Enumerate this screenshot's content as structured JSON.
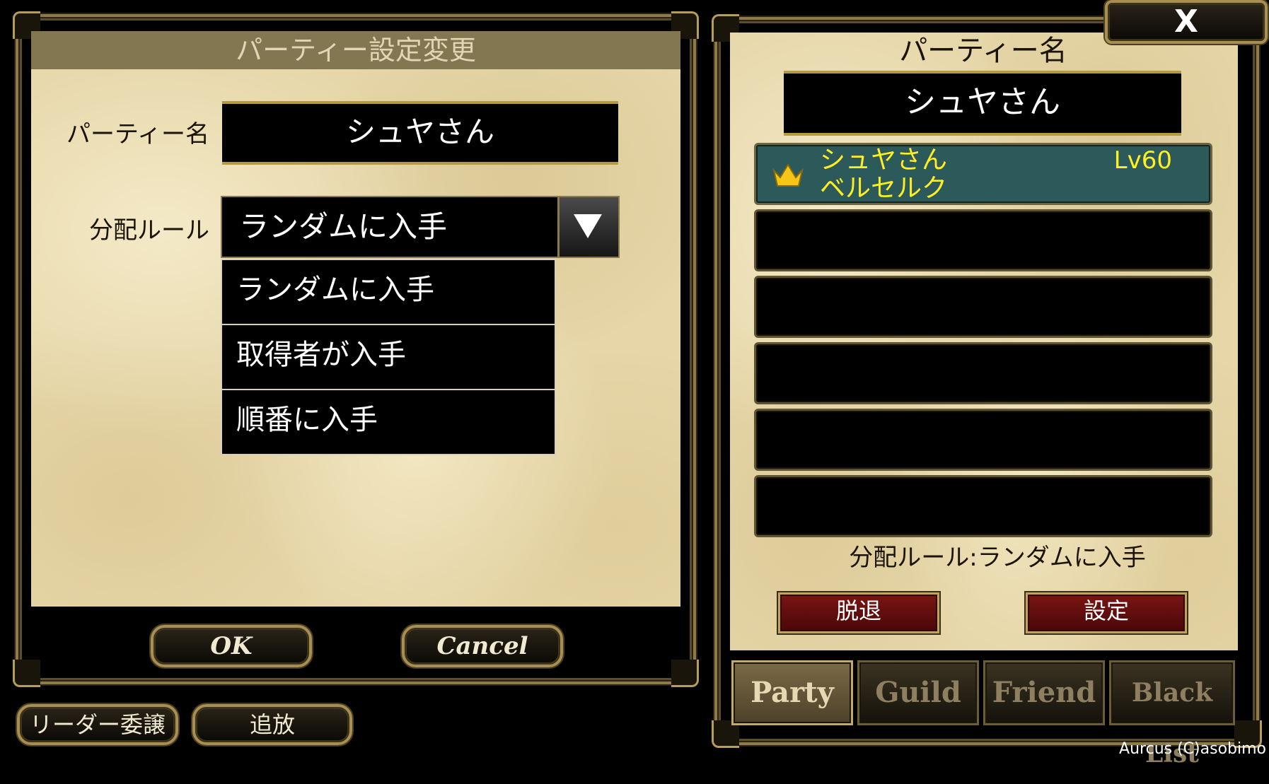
{
  "settings_dialog": {
    "title": "パーティー設定変更",
    "party_name_label": "パーティー名",
    "party_name_value": "シュヤさん",
    "distribution_label": "分配ルール",
    "distribution_selected": "ランダムに入手",
    "dropdown_options": [
      "ランダムに入手",
      "取得者が入手",
      "順番に入手"
    ],
    "ok_label": "OK",
    "cancel_label": "Cancel"
  },
  "bottom_buttons": {
    "transfer_leader_label": "リーダー委譲",
    "kick_label": "追放"
  },
  "party_panel": {
    "close_label": "X",
    "party_name_header": "パーティー名",
    "party_name_value": "シュヤさん",
    "members": [
      {
        "name": "シュヤさん",
        "class": "ベルセルク",
        "level": "Lv60",
        "is_leader": true
      }
    ],
    "empty_slots": 5,
    "distribution_rule_text": "分配ルール:ランダムに入手",
    "leave_label": "脱退",
    "settings_label": "設定",
    "tabs": [
      {
        "label": "Party",
        "active": true
      },
      {
        "label": "Guild",
        "active": false
      },
      {
        "label": "Friend",
        "active": false
      },
      {
        "label": "Black List",
        "active": false
      }
    ]
  },
  "copyright": "Aurcus (C)asobimo",
  "colors": {
    "member_row_bg": "#2c5a5a",
    "member_text": "#ffee22",
    "leader_icon": "#f5c518",
    "parchment": "#e6d6a8",
    "gold_frame": "#a88e52",
    "red_button": "#6b0f0f"
  },
  "icons": {
    "leader": "crown-icon",
    "dropdown": "triangle-down-icon",
    "close": "x-icon"
  }
}
